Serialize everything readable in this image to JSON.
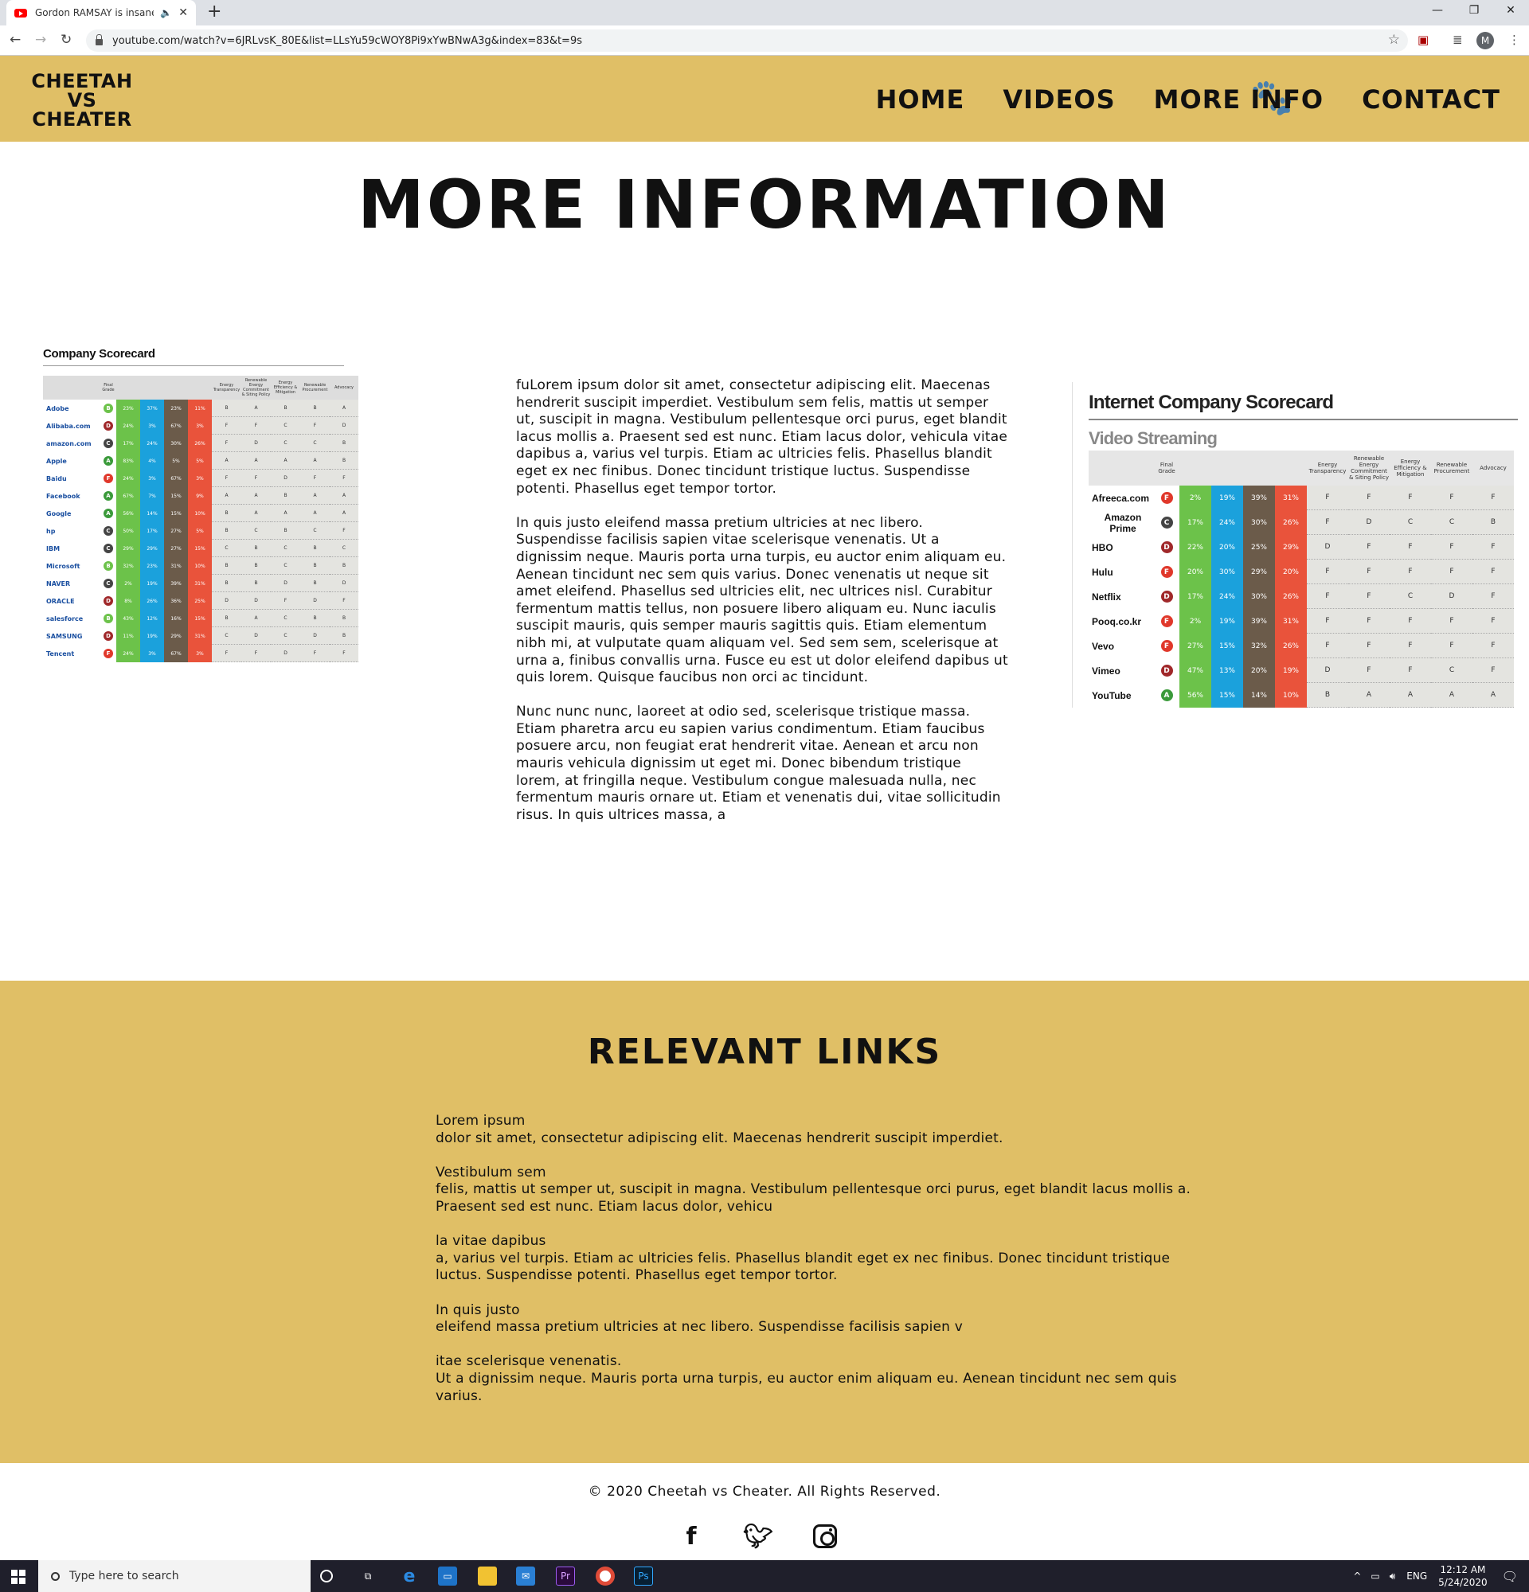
{
  "browser": {
    "tab_title": "Gordon RAMSAY is insane!!!",
    "new_tab": "+",
    "url": "youtube.com/watch?v=6JRLvsK_80E&list=LLsYu59cWOY8Pi9xYwBNwA3g&index=83&t=9s",
    "profile_initial": "M"
  },
  "site": {
    "logo_lines": [
      "CHEETAH",
      "VS",
      "CHEATER"
    ],
    "nav": [
      "HOME",
      "VIDEOS",
      "MORE INFO",
      "CONTACT"
    ],
    "page_title": "MORE INFORMATION"
  },
  "scorecard_left": {
    "title": "Company Scorecard",
    "header": [
      "",
      "Final Grade",
      "",
      "",
      "",
      "",
      "Energy Transparency",
      "Renewable Energy Commitment & Siting Policy",
      "Energy Efficiency & Mitigation",
      "Renewable Procurement",
      "Advocacy"
    ],
    "rows": [
      {
        "company": "Adobe",
        "grade": "B",
        "vals": [
          "23%",
          "37%",
          "23%",
          "11%"
        ],
        "letters": [
          "B",
          "A",
          "B",
          "B",
          "A"
        ]
      },
      {
        "company": "Alibaba.com",
        "grade": "D",
        "vals": [
          "24%",
          "3%",
          "67%",
          "3%"
        ],
        "letters": [
          "F",
          "F",
          "C",
          "F",
          "D"
        ]
      },
      {
        "company": "amazon.com",
        "grade": "C",
        "vals": [
          "17%",
          "24%",
          "30%",
          "26%"
        ],
        "letters": [
          "F",
          "D",
          "C",
          "C",
          "B"
        ]
      },
      {
        "company": "Apple",
        "grade": "A",
        "vals": [
          "83%",
          "4%",
          "5%",
          "5%"
        ],
        "letters": [
          "A",
          "A",
          "A",
          "A",
          "B"
        ]
      },
      {
        "company": "Baidu",
        "grade": "F",
        "vals": [
          "24%",
          "3%",
          "67%",
          "3%"
        ],
        "letters": [
          "F",
          "F",
          "D",
          "F",
          "F"
        ]
      },
      {
        "company": "Facebook",
        "grade": "A",
        "vals": [
          "67%",
          "7%",
          "15%",
          "9%"
        ],
        "letters": [
          "A",
          "A",
          "B",
          "A",
          "A"
        ]
      },
      {
        "company": "Google",
        "grade": "A",
        "vals": [
          "56%",
          "14%",
          "15%",
          "10%"
        ],
        "letters": [
          "B",
          "A",
          "A",
          "A",
          "A"
        ]
      },
      {
        "company": "hp",
        "grade": "C",
        "vals": [
          "50%",
          "17%",
          "27%",
          "5%"
        ],
        "letters": [
          "B",
          "C",
          "B",
          "C",
          "F"
        ]
      },
      {
        "company": "IBM",
        "grade": "C",
        "vals": [
          "29%",
          "29%",
          "27%",
          "15%"
        ],
        "letters": [
          "C",
          "B",
          "C",
          "B",
          "C"
        ]
      },
      {
        "company": "Microsoft",
        "grade": "B",
        "vals": [
          "32%",
          "23%",
          "31%",
          "10%"
        ],
        "letters": [
          "B",
          "B",
          "C",
          "B",
          "B"
        ]
      },
      {
        "company": "NAVER",
        "grade": "C",
        "vals": [
          "2%",
          "19%",
          "39%",
          "31%"
        ],
        "letters": [
          "B",
          "B",
          "D",
          "B",
          "D"
        ]
      },
      {
        "company": "ORACLE",
        "grade": "D",
        "vals": [
          "8%",
          "26%",
          "36%",
          "25%"
        ],
        "letters": [
          "D",
          "D",
          "F",
          "D",
          "F"
        ]
      },
      {
        "company": "salesforce",
        "grade": "B",
        "vals": [
          "43%",
          "12%",
          "16%",
          "15%"
        ],
        "letters": [
          "B",
          "A",
          "C",
          "B",
          "B"
        ]
      },
      {
        "company": "SAMSUNG",
        "grade": "D",
        "vals": [
          "11%",
          "19%",
          "29%",
          "31%"
        ],
        "letters": [
          "C",
          "D",
          "C",
          "D",
          "B"
        ]
      },
      {
        "company": "Tencent",
        "grade": "F",
        "vals": [
          "24%",
          "3%",
          "67%",
          "3%"
        ],
        "letters": [
          "F",
          "F",
          "D",
          "F",
          "F"
        ]
      }
    ]
  },
  "body_paragraphs": [
    "fuLorem ipsum dolor sit amet, consectetur adipiscing elit. Maecenas hendrerit suscipit imperdiet. Vestibulum sem felis, mattis ut semper ut, suscipit in magna. Vestibulum pellentesque orci purus, eget blandit lacus mollis a. Praesent sed est nunc. Etiam lacus dolor, vehicula vitae dapibus a, varius vel turpis. Etiam ac ultricies felis. Phasellus blandit eget ex nec finibus. Donec tincidunt tristique luctus. Suspendisse potenti. Phasellus eget tempor tortor.",
    "In quis justo eleifend massa pretium ultricies at nec libero. Suspendisse facilisis sapien vitae scelerisque venenatis. Ut a dignissim neque. Mauris porta urna turpis, eu auctor enim aliquam eu. Aenean tincidunt nec sem quis varius. Donec venenatis ut neque sit amet eleifend. Phasellus sed ultricies elit, nec ultrices nisl. Curabitur fermentum mattis tellus, non posuere libero aliquam eu. Nunc iaculis suscipit mauris, quis semper mauris sagittis quis. Etiam elementum nibh mi, at vulputate quam aliquam vel. Sed sem sem, scelerisque at urna a, finibus convallis urna. Fusce eu est ut dolor eleifend dapibus ut quis lorem. Quisque faucibus non orci ac tincidunt.",
    "Nunc nunc nunc, laoreet at odio sed, scelerisque tristique massa. Etiam pharetra arcu eu sapien varius condimentum. Etiam faucibus posuere arcu, non feugiat erat hendrerit vitae. Aenean et arcu non mauris vehicula dignissim ut eget mi. Donec bibendum tristique lorem, at fringilla neque. Vestibulum congue malesuada nulla, nec fermentum mauris ornare ut. Etiam et venenatis dui, vitae sollicitudin risus. In quis ultrices massa, a"
  ],
  "scorecard_right": {
    "title": "Internet Company Scorecard",
    "subtitle": "Video Streaming",
    "header": [
      "",
      "Final Grade",
      "",
      "",
      "",
      "",
      "Energy Transparency",
      "Renewable Energy Commitment & Siting Policy",
      "Energy Efficiency & Mitigation",
      "Renewable Procurement",
      "Advocacy"
    ],
    "rows": [
      {
        "company": "Afreeca.com",
        "grade": "F",
        "vals": [
          "2%",
          "19%",
          "39%",
          "31%"
        ],
        "letters": [
          "F",
          "F",
          "F",
          "F",
          "F"
        ]
      },
      {
        "company": "Amazon Prime",
        "grade": "C",
        "vals": [
          "17%",
          "24%",
          "30%",
          "26%"
        ],
        "letters": [
          "F",
          "D",
          "C",
          "C",
          "B"
        ]
      },
      {
        "company": "HBO",
        "grade": "D",
        "vals": [
          "22%",
          "20%",
          "25%",
          "29%"
        ],
        "letters": [
          "D",
          "F",
          "F",
          "F",
          "F"
        ]
      },
      {
        "company": "Hulu",
        "grade": "F",
        "vals": [
          "20%",
          "30%",
          "29%",
          "20%"
        ],
        "letters": [
          "F",
          "F",
          "F",
          "F",
          "F"
        ]
      },
      {
        "company": "Netflix",
        "grade": "D",
        "vals": [
          "17%",
          "24%",
          "30%",
          "26%"
        ],
        "letters": [
          "F",
          "F",
          "C",
          "D",
          "F"
        ]
      },
      {
        "company": "Pooq.co.kr",
        "grade": "F",
        "vals": [
          "2%",
          "19%",
          "39%",
          "31%"
        ],
        "letters": [
          "F",
          "F",
          "F",
          "F",
          "F"
        ]
      },
      {
        "company": "Vevo",
        "grade": "F",
        "vals": [
          "27%",
          "15%",
          "32%",
          "26%"
        ],
        "letters": [
          "F",
          "F",
          "F",
          "F",
          "F"
        ]
      },
      {
        "company": "Vimeo",
        "grade": "D",
        "vals": [
          "47%",
          "13%",
          "20%",
          "19%"
        ],
        "letters": [
          "D",
          "F",
          "F",
          "C",
          "F"
        ]
      },
      {
        "company": "YouTube",
        "grade": "A",
        "vals": [
          "56%",
          "15%",
          "14%",
          "10%"
        ],
        "letters": [
          "B",
          "A",
          "A",
          "A",
          "A"
        ]
      }
    ]
  },
  "links_section": {
    "title": "RELEVANT LINKS",
    "groups": [
      {
        "head": "Lorem ipsum",
        "text": "dolor sit amet, consectetur adipiscing elit. Maecenas hendrerit suscipit imperdiet."
      },
      {
        "head": "Vestibulum sem",
        "text": "felis, mattis ut semper ut, suscipit in magna. Vestibulum pellentesque orci purus, eget blandit lacus mollis a. Praesent sed est nunc. Etiam lacus dolor, vehicu"
      },
      {
        "head": "la vitae dapibus",
        "text": "a, varius vel turpis. Etiam ac ultricies felis. Phasellus blandit eget ex nec finibus. Donec tincidunt tristique luctus. Suspendisse potenti. Phasellus eget tempor tortor."
      },
      {
        "head": "In quis justo",
        "text": "eleifend massa pretium ultricies at nec libero. Suspendisse facilisis sapien v"
      },
      {
        "head": "itae scelerisque venenatis.",
        "text": " Ut a dignissim neque. Mauris porta urna turpis, eu auctor enim aliquam eu. Aenean tincidunt nec sem quis varius."
      }
    ]
  },
  "footer": {
    "copyright": "© 2020 Cheetah vs Cheater. All Rights Reserved.",
    "social": [
      "facebook-icon",
      "twitter-icon",
      "instagram-icon"
    ]
  },
  "taskbar": {
    "search_placeholder": "Type here to search",
    "lang": "ENG",
    "time": "12:12 AM",
    "date": "5/24/2020"
  },
  "colors": {
    "brand_gold": "#e0bf66",
    "grade_colors": {
      "A": "#3a9a3a",
      "B": "#6cc24a",
      "C": "#444444",
      "D": "#a0282a",
      "F": "#e0382b"
    }
  }
}
